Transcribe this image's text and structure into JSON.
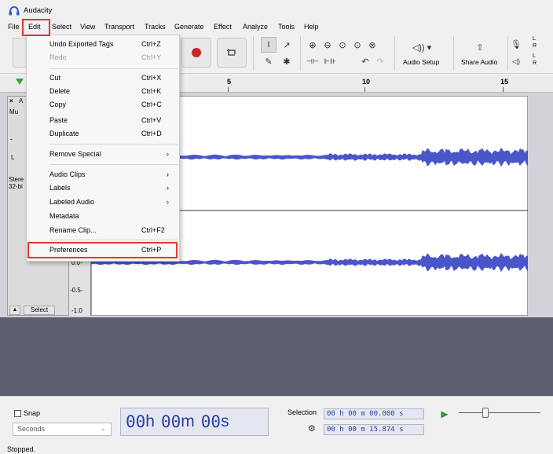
{
  "window": {
    "title": "Audacity",
    "status": "Stopped."
  },
  "menubar": [
    "File",
    "Edit",
    "Select",
    "View",
    "Transport",
    "Tracks",
    "Generate",
    "Effect",
    "Analyze",
    "Tools",
    "Help"
  ],
  "edit_menu": {
    "items": [
      {
        "label": "Undo Exported Tags",
        "shortcut": "Ctrl+Z",
        "enabled": true
      },
      {
        "label": "Redo",
        "shortcut": "Ctrl+Y",
        "enabled": false
      },
      {
        "label": "Cut",
        "shortcut": "Ctrl+X",
        "enabled": true
      },
      {
        "label": "Delete",
        "shortcut": "Ctrl+K",
        "enabled": true
      },
      {
        "label": "Copy",
        "shortcut": "Ctrl+C",
        "enabled": true
      },
      {
        "label": "Paste",
        "shortcut": "Ctrl+V",
        "enabled": true
      },
      {
        "label": "Duplicate",
        "shortcut": "Ctrl+D",
        "enabled": true
      },
      {
        "label": "Remove Special",
        "submenu": true
      },
      {
        "label": "Audio Clips",
        "submenu": true
      },
      {
        "label": "Labels",
        "submenu": true
      },
      {
        "label": "Labeled Audio",
        "submenu": true
      },
      {
        "label": "Metadata"
      },
      {
        "label": "Rename Clip...",
        "shortcut": "Ctrl+F2"
      },
      {
        "label": "Preferences",
        "shortcut": "Ctrl+P",
        "highlighted": true
      }
    ]
  },
  "toolbar": {
    "audio_setup": "Audio Setup",
    "share_audio": "Share Audio",
    "meter_letters": [
      "L",
      "R",
      "L",
      "R"
    ]
  },
  "ruler": {
    "labels": [
      "5",
      "10",
      "15"
    ]
  },
  "track": {
    "close_glyph": "×",
    "name_fragment": "A",
    "mute_fragment": "Mu",
    "minus_fragment": "-",
    "pan_fragment": "L",
    "format_fragment_1": "Stere",
    "format_fragment_2": "32-bi",
    "select_button": "Select",
    "collapse_glyph": "▲",
    "scale_labels": [
      "0.0-",
      "-0.5-",
      "-1.0"
    ]
  },
  "bottom": {
    "snap_label": "Snap",
    "snap_checked": false,
    "snap_unit": "Seconds",
    "time_display": {
      "hours": "00",
      "h": "h",
      "minutes": "00",
      "m": "m",
      "seconds": "00",
      "s": "s"
    },
    "selection_label": "Selection",
    "selection_start": "00 h 00 m 00.000 s",
    "selection_end": "00 h 00 m 15.874 s"
  },
  "colors": {
    "waveform": "#4a55c8",
    "highlight_box": "#e8352d",
    "time_text": "#2b3ea0",
    "record": "#c62828",
    "play_green": "#2e9a3a"
  }
}
